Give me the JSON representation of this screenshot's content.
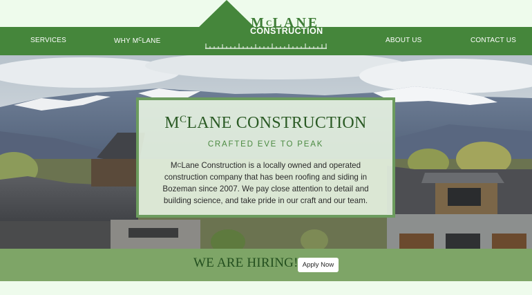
{
  "nav": {
    "services": "SERVICES",
    "why_prefix": "WHY M",
    "why_sup": "C",
    "why_suffix": "LANE",
    "about": "ABOUT US",
    "contact": "CONTACT US"
  },
  "logo": {
    "name_prefix": "M",
    "name_sup": "C",
    "name_suffix": "LANE",
    "subtitle": "CONSTRUCTION"
  },
  "hero": {
    "title_prefix": "M",
    "title_sup": "C",
    "title_suffix": "LANE CONSTRUCTION",
    "tagline": "CRAFTED EVE TO PEAK",
    "body_prefix": "M",
    "body_sup": "C",
    "body_suffix": "Lane Construction is a locally owned and operated construction company that has been roofing and siding in Bozeman since 2007. We pay close attention to detail and building science, and take pride in our craft and our team."
  },
  "banner": {
    "hiring_text": "WE ARE HIRING!",
    "apply_label": "Apply Now"
  },
  "colors": {
    "brand_green": "#45863b",
    "page_bg": "#eefbec",
    "banner_green": "#7ea567",
    "title_green": "#2a5a24"
  }
}
